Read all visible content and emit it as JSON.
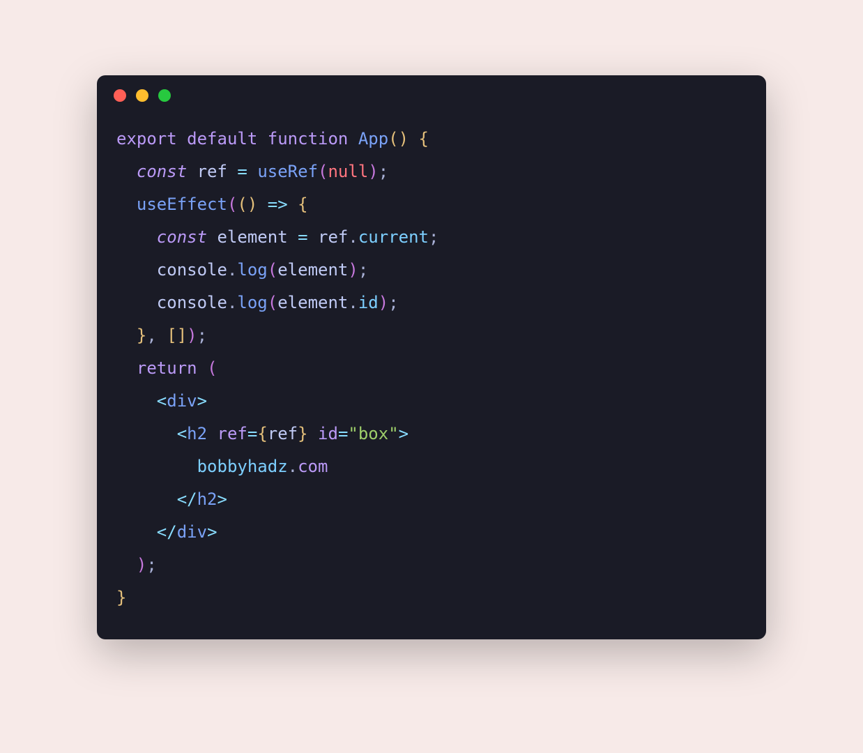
{
  "window": {
    "traffic_lights": [
      "close",
      "minimize",
      "maximize"
    ]
  },
  "code": {
    "tokens": [
      [
        {
          "text": "export",
          "class": "tok-keyword2"
        },
        {
          "text": " ",
          "class": ""
        },
        {
          "text": "default",
          "class": "tok-keyword2"
        },
        {
          "text": " ",
          "class": ""
        },
        {
          "text": "function",
          "class": "tok-keyword2"
        },
        {
          "text": " ",
          "class": ""
        },
        {
          "text": "App",
          "class": "tok-function-name"
        },
        {
          "text": "(",
          "class": "tok-bracket"
        },
        {
          "text": ")",
          "class": "tok-bracket"
        },
        {
          "text": " ",
          "class": ""
        },
        {
          "text": "{",
          "class": "tok-bracket"
        }
      ],
      [
        {
          "text": "  ",
          "class": ""
        },
        {
          "text": "const",
          "class": "tok-keyword"
        },
        {
          "text": " ",
          "class": ""
        },
        {
          "text": "ref",
          "class": "tok-variable"
        },
        {
          "text": " ",
          "class": ""
        },
        {
          "text": "=",
          "class": "tok-operator"
        },
        {
          "text": " ",
          "class": ""
        },
        {
          "text": "useRef",
          "class": "tok-function-call"
        },
        {
          "text": "(",
          "class": "tok-bracket2"
        },
        {
          "text": "null",
          "class": "tok-null"
        },
        {
          "text": ")",
          "class": "tok-bracket2"
        },
        {
          "text": ";",
          "class": "tok-punct"
        }
      ],
      [
        {
          "text": "  ",
          "class": ""
        },
        {
          "text": "useEffect",
          "class": "tok-function-call"
        },
        {
          "text": "(",
          "class": "tok-bracket2"
        },
        {
          "text": "(",
          "class": "tok-bracket"
        },
        {
          "text": ")",
          "class": "tok-bracket"
        },
        {
          "text": " ",
          "class": ""
        },
        {
          "text": "=>",
          "class": "tok-operator"
        },
        {
          "text": " ",
          "class": ""
        },
        {
          "text": "{",
          "class": "tok-bracket"
        }
      ],
      [
        {
          "text": "    ",
          "class": ""
        },
        {
          "text": "const",
          "class": "tok-keyword"
        },
        {
          "text": " ",
          "class": ""
        },
        {
          "text": "element",
          "class": "tok-variable"
        },
        {
          "text": " ",
          "class": ""
        },
        {
          "text": "=",
          "class": "tok-operator"
        },
        {
          "text": " ",
          "class": ""
        },
        {
          "text": "ref",
          "class": "tok-variable"
        },
        {
          "text": ".",
          "class": "tok-punct"
        },
        {
          "text": "current",
          "class": "tok-prop2"
        },
        {
          "text": ";",
          "class": "tok-punct"
        }
      ],
      [
        {
          "text": "    ",
          "class": ""
        },
        {
          "text": "console",
          "class": "tok-variable"
        },
        {
          "text": ".",
          "class": "tok-punct"
        },
        {
          "text": "log",
          "class": "tok-function-call"
        },
        {
          "text": "(",
          "class": "tok-bracket2"
        },
        {
          "text": "element",
          "class": "tok-variable"
        },
        {
          "text": ")",
          "class": "tok-bracket2"
        },
        {
          "text": ";",
          "class": "tok-punct"
        }
      ],
      [
        {
          "text": "    ",
          "class": ""
        },
        {
          "text": "console",
          "class": "tok-variable"
        },
        {
          "text": ".",
          "class": "tok-punct"
        },
        {
          "text": "log",
          "class": "tok-function-call"
        },
        {
          "text": "(",
          "class": "tok-bracket2"
        },
        {
          "text": "element",
          "class": "tok-variable"
        },
        {
          "text": ".",
          "class": "tok-punct"
        },
        {
          "text": "id",
          "class": "tok-prop2"
        },
        {
          "text": ")",
          "class": "tok-bracket2"
        },
        {
          "text": ";",
          "class": "tok-punct"
        }
      ],
      [
        {
          "text": "  ",
          "class": ""
        },
        {
          "text": "}",
          "class": "tok-bracket"
        },
        {
          "text": ",",
          "class": "tok-punct"
        },
        {
          "text": " ",
          "class": ""
        },
        {
          "text": "[",
          "class": "tok-bracket"
        },
        {
          "text": "]",
          "class": "tok-bracket"
        },
        {
          "text": ")",
          "class": "tok-bracket2"
        },
        {
          "text": ";",
          "class": "tok-punct"
        }
      ],
      [
        {
          "text": "  ",
          "class": ""
        },
        {
          "text": "return",
          "class": "tok-keyword2"
        },
        {
          "text": " ",
          "class": ""
        },
        {
          "text": "(",
          "class": "tok-bracket2"
        }
      ],
      [
        {
          "text": "    ",
          "class": ""
        },
        {
          "text": "<",
          "class": "tok-angle"
        },
        {
          "text": "div",
          "class": "tok-tag"
        },
        {
          "text": ">",
          "class": "tok-angle"
        }
      ],
      [
        {
          "text": "      ",
          "class": ""
        },
        {
          "text": "<",
          "class": "tok-angle"
        },
        {
          "text": "h2",
          "class": "tok-tag"
        },
        {
          "text": " ",
          "class": ""
        },
        {
          "text": "ref",
          "class": "tok-attr"
        },
        {
          "text": "=",
          "class": "tok-operator"
        },
        {
          "text": "{",
          "class": "tok-bracket"
        },
        {
          "text": "ref",
          "class": "tok-variable"
        },
        {
          "text": "}",
          "class": "tok-bracket"
        },
        {
          "text": " ",
          "class": ""
        },
        {
          "text": "id",
          "class": "tok-attr"
        },
        {
          "text": "=",
          "class": "tok-operator"
        },
        {
          "text": "\"box\"",
          "class": "tok-string"
        },
        {
          "text": ">",
          "class": "tok-angle"
        }
      ],
      [
        {
          "text": "        ",
          "class": ""
        },
        {
          "text": "bobbyhadz",
          "class": "tok-text"
        },
        {
          "text": ".",
          "class": "tok-punct"
        },
        {
          "text": "com",
          "class": "tok-text2"
        }
      ],
      [
        {
          "text": "      ",
          "class": ""
        },
        {
          "text": "</",
          "class": "tok-angle"
        },
        {
          "text": "h2",
          "class": "tok-tag"
        },
        {
          "text": ">",
          "class": "tok-angle"
        }
      ],
      [
        {
          "text": "    ",
          "class": ""
        },
        {
          "text": "</",
          "class": "tok-angle"
        },
        {
          "text": "div",
          "class": "tok-tag"
        },
        {
          "text": ">",
          "class": "tok-angle"
        }
      ],
      [
        {
          "text": "  ",
          "class": ""
        },
        {
          "text": ")",
          "class": "tok-bracket2"
        },
        {
          "text": ";",
          "class": "tok-punct"
        }
      ],
      [
        {
          "text": "}",
          "class": "tok-bracket"
        }
      ]
    ]
  }
}
